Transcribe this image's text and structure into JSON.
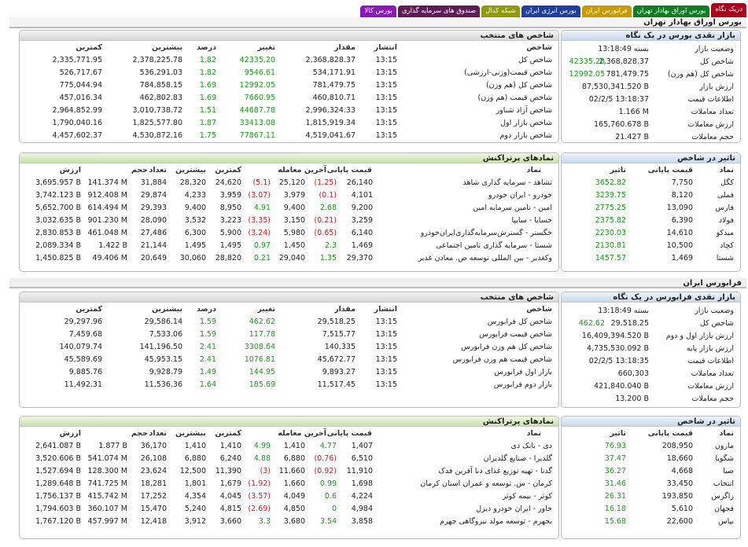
{
  "tabs": [
    {
      "label": "دریک نگاه",
      "color": "#a8001c",
      "active": true
    },
    {
      "label": "بورس اوراق بهادار تهران",
      "color": "#127c24"
    },
    {
      "label": "فرابورس ایران",
      "color": "#c99a00"
    },
    {
      "label": "بورس انرژی ایران",
      "color": "#1f3e9e"
    },
    {
      "label": "شبکه کدال",
      "color": "#8f9a05"
    },
    {
      "label": "صندوق های سرمایه گذاری",
      "color": "#5e1c56"
    },
    {
      "label": "بورس کالا",
      "color": "#8a1ab5"
    }
  ],
  "tehran": {
    "section_title": "بورس اوراق بهادار تهران",
    "overview": {
      "title": "بازار نقدی بورس در یک نگاه",
      "rows": [
        {
          "label": "وضعیت بازار",
          "value": "بسته 13:18:49",
          "change": ""
        },
        {
          "label": "شاخص کل",
          "value": "2,368,828.37",
          "change": "42335.20"
        },
        {
          "label": "شاخص کل (هم وزن)",
          "value": "781,479.75",
          "change": "12992.05"
        },
        {
          "label": "ارزش بازار",
          "value": "87,530,341.520 B",
          "change": ""
        },
        {
          "label": "اطلاعات قیمت",
          "value": "02/2/5 13:18:37",
          "change": ""
        },
        {
          "label": "تعداد معاملات",
          "value": "1.166 M",
          "change": ""
        },
        {
          "label": "ارزش معاملات",
          "value": "165,760.678 B",
          "change": ""
        },
        {
          "label": "حجم معاملات",
          "value": "21.427 B",
          "change": ""
        }
      ]
    },
    "indices": {
      "title": "شاخص های منتخب",
      "headers": [
        "شاخص",
        "انتشار",
        "مقدار",
        "تغییر",
        "درصد",
        "بیشترین",
        "کمترین"
      ],
      "rows": [
        [
          "شاخص کل",
          "13:15",
          "2,368,828.37",
          "42335.20",
          "1.82",
          "2,378,225.78",
          "2,335,771.95"
        ],
        [
          "شاخص قیمت(وزنی-ارزشی)",
          "13:15",
          "534,171.91",
          "9546.61",
          "1.82",
          "536,291.03",
          "526,717.67"
        ],
        [
          "شاخص کل (هم وزن)",
          "13:15",
          "781,479.75",
          "12992.05",
          "1.69",
          "784,858.15",
          "775,044.94"
        ],
        [
          "شاخص قیمت (هم وزن)",
          "13:15",
          "460,810.71",
          "7660.95",
          "1.69",
          "462,802.83",
          "457,016.34"
        ],
        [
          "شاخص آزاد شناور",
          "13:15",
          "2,996,324.33",
          "44687.78",
          "1.51",
          "3,010,738.72",
          "2,964,852.99"
        ],
        [
          "شاخص بازار اول",
          "13:15",
          "1,815,919.34",
          "33413.08",
          "1.87",
          "1,825,577.80",
          "1,790,040.16"
        ],
        [
          "شاخص بازار دوم",
          "13:15",
          "4,519,041.67",
          "77867.11",
          "1.75",
          "4,530,872.16",
          "4,457,602.37"
        ]
      ]
    },
    "impact": {
      "title": "تاثیر در شاخص",
      "headers": [
        "نماد",
        "قیمت پایانی",
        "تاثیر"
      ],
      "rows": [
        [
          "کگل",
          "7,750",
          "3652.82"
        ],
        [
          "فملی",
          "8,120",
          "3239.75"
        ],
        [
          "فارس",
          "13,090",
          "2775.25"
        ],
        [
          "فولاد",
          "6,390",
          "2375.82"
        ],
        [
          "میدکو",
          "14,610",
          "2230.03"
        ],
        [
          "کچاد",
          "10,500",
          "2130.81"
        ],
        [
          "شستا",
          "1,469",
          "1457.57"
        ]
      ]
    },
    "popular": {
      "title": "نمادهای پرتراکنش",
      "headers": [
        "نماد",
        "قیمت پایانی",
        "آخرین معامله",
        "کمترین",
        "بیشترین",
        "تعداد",
        "حجم",
        "ارزش"
      ],
      "rows": [
        {
          "name": "تشاهد - سرمایه گذاری شاهد",
          "close": "26,140",
          "close_chg": "(1.25)",
          "last": "25,120",
          "last_chg": "(5.1)",
          "min": "24,620",
          "max": "28,320",
          "count": "31,884",
          "vol": "141.374 M",
          "val": "3,695.957 B",
          "neg": true
        },
        {
          "name": "خودرو - ایران خودرو",
          "close": "4,101",
          "close_chg": "(0.1)",
          "last": "3,979",
          "last_chg": "(3.07)",
          "min": "3,959",
          "max": "4,233",
          "count": "29,874",
          "vol": "912.408 M",
          "val": "3,742.123 B",
          "neg": true
        },
        {
          "name": "امین - تامین سرمایه امین",
          "close": "9,200",
          "close_chg": "2.68",
          "last": "9,400",
          "last_chg": "4.91",
          "min": "8,950",
          "max": "9,400",
          "count": "29,393",
          "vol": "614.494 M",
          "val": "5,652.700 B",
          "neg": false
        },
        {
          "name": "خسایا - سایپا",
          "close": "3,259",
          "close_chg": "(0.21)",
          "last": "3,150",
          "last_chg": "(3.35)",
          "min": "3,223",
          "max": "3,532",
          "count": "28,090",
          "vol": "901.230 M",
          "val": "3,032.635 B",
          "neg": true
        },
        {
          "name": "خگستر - گسترش‌سرمایه‌گذاری‌ایران‌خودرو",
          "close": "6,140",
          "close_chg": "(0.65)",
          "last": "5,980",
          "last_chg": "(3.24)",
          "min": "5,900",
          "max": "6,300",
          "count": "27,486",
          "vol": "461.048 M",
          "val": "2,830.853 B",
          "neg": true
        },
        {
          "name": "شستا - سرمایه گذاری تامین اجتماعی",
          "close": "1,469",
          "close_chg": "2.3",
          "last": "1,450",
          "last_chg": "0.97",
          "min": "1,495",
          "max": "1,495",
          "count": "21,144",
          "vol": "1.422 B",
          "val": "2,089.334 B",
          "neg": false
        },
        {
          "name": "وکغدیر - بین المللی توسعه ص. معادن غدیر",
          "close": "29,370",
          "close_chg": "1.35",
          "last": "29,040",
          "last_chg": "0.21",
          "min": "28,820",
          "max": "30,060",
          "count": "20,649",
          "vol": "49.406 M",
          "val": "1,450.825 B",
          "neg": false
        }
      ]
    }
  },
  "ifb": {
    "section_title": "فرابورس ایران",
    "overview": {
      "title": "بازار نقدی فرابورس در یک نگاه",
      "rows": [
        {
          "label": "وضعیت بازار",
          "value": "بسته 13:18:49",
          "change": ""
        },
        {
          "label": "شاخص کل",
          "value": "29,518.25",
          "change": "462.62"
        },
        {
          "label": "ارزش بازار اول و دوم",
          "value": "16,409,394.520 B",
          "change": ""
        },
        {
          "label": "ارزش بازار پایه",
          "value": "4,735,530.092 B",
          "change": ""
        },
        {
          "label": "اطلاعات قیمت",
          "value": "02/2/5 13:18:35",
          "change": ""
        },
        {
          "label": "تعداد معاملات",
          "value": "660,303",
          "change": ""
        },
        {
          "label": "ارزش معاملات",
          "value": "421,840.040 B",
          "change": ""
        },
        {
          "label": "حجم معاملات",
          "value": "13.200 B",
          "change": ""
        }
      ]
    },
    "indices": {
      "title": "شاخص های منتخب",
      "headers": [
        "شاخص",
        "انتشار",
        "مقدار",
        "تغییر",
        "درصد",
        "بیشترین",
        "کمترین"
      ],
      "rows": [
        [
          "شاخص کل فرابورس",
          "13:15",
          "29,518.25",
          "462.62",
          "1.59",
          "29,586.14",
          "29,297.96"
        ],
        [
          "شاخص قیمت فرابورس",
          "13:15",
          "7,515.77",
          "117.78",
          "1.59",
          "7,533.06",
          "7,459.68"
        ],
        [
          "شاخص کل هم وزن فرابورس",
          "13:15",
          "140,335",
          "3308.64",
          "2.41",
          "141,196.50",
          "140,079.74"
        ],
        [
          "شاخص قیمت هم وزن فرابورس",
          "13:15",
          "45,672.77",
          "1076.81",
          "2.41",
          "45,953.15",
          "45,589.69"
        ],
        [
          "بازار اول فرابورس",
          "13:15",
          "9,893.27",
          "144.95",
          "1.49",
          "9,928.79",
          "9,885.76"
        ],
        [
          "بازار دوم فرابورس",
          "13:15",
          "11,517.45",
          "185.69",
          "1.64",
          "11,536.36",
          "11,492.31"
        ]
      ]
    },
    "impact": {
      "title": "تاثیر در شاخص",
      "headers": [
        "نماد",
        "قیمت پایانی",
        "تاثیر"
      ],
      "rows": [
        [
          "مارون",
          "208,950",
          "76.93"
        ],
        [
          "شگویا",
          "18,660",
          "37.47"
        ],
        [
          "صبا",
          "4,668",
          "36.27"
        ],
        [
          "انتخاب",
          "33,450",
          "31.46"
        ],
        [
          "زاگرس",
          "193,850",
          "26.31"
        ],
        [
          "فجهان",
          "5,610",
          "16.18"
        ],
        [
          "بپاس",
          "22,600",
          "15.68"
        ]
      ]
    },
    "popular": {
      "title": "نمادهای پرتراکنش",
      "headers": [
        "نماد",
        "قیمت پایانی",
        "آخرین معامله",
        "کمترین",
        "بیشترین",
        "تعداد",
        "حجم",
        "ارزش"
      ],
      "rows": [
        {
          "name": "دی - بانک دی",
          "close": "1,407",
          "close_chg": "4.77",
          "last": "1,410",
          "last_chg": "4.99",
          "min": "1,410",
          "max": "1,410",
          "count": "36,170",
          "vol": "1.877 B",
          "val": "2,641.087 B",
          "neg": false
        },
        {
          "name": "گلدیرا - صنایع گلدیران",
          "close": "6,510",
          "close_chg": "(0.76)",
          "last": "6,880",
          "last_chg": "4.88",
          "min": "6,240",
          "max": "6,880",
          "count": "26,108",
          "vol": "541.074 M",
          "val": "3,520.606 B",
          "neg": true
        },
        {
          "name": "گدنا - تهیه توزیع غذای دنا آفرین فدک",
          "close": "11,910",
          "close_chg": "(0.92)",
          "last": "11,660",
          "last_chg": "(3)",
          "min": "11,390",
          "max": "12,500",
          "count": "23,624",
          "vol": "128.300 M",
          "val": "1,527.694 B",
          "neg": true
        },
        {
          "name": "کرمان - س. توسعه و عمران استان کرمان",
          "close": "1,698",
          "close_chg": "0.99",
          "last": "1,660",
          "last_chg": "(1.92)",
          "min": "1,679",
          "max": "1,801",
          "count": "18,281",
          "vol": "741.725 M",
          "val": "1,289.648 B",
          "neg": false
        },
        {
          "name": "کوثر - بیمه کوثر",
          "close": "4,224",
          "close_chg": "0.6",
          "last": "4,049",
          "last_chg": "(3.57)",
          "min": "4,045",
          "max": "4,354",
          "count": "17,252",
          "vol": "415.742 M",
          "val": "1,756.137 B",
          "neg": false
        },
        {
          "name": "خاور - ایران خودرو دیزل",
          "close": "4,984",
          "close_chg": "0",
          "last": "4,850",
          "last_chg": "(2.69)",
          "min": "4,815",
          "max": "5,240",
          "count": "15,470",
          "vol": "360.107 M",
          "val": "1,794.603 B",
          "neg": false
        },
        {
          "name": "بجهرم - توسعه مولد نیروگاهی جهرم",
          "close": "3,858",
          "close_chg": "3.54",
          "last": "3,680",
          "last_chg": "3.3",
          "min": "3,660",
          "max": "3,912",
          "count": "12,418",
          "vol": "457.997 M",
          "val": "1,767.120 B",
          "neg": false
        }
      ]
    }
  }
}
